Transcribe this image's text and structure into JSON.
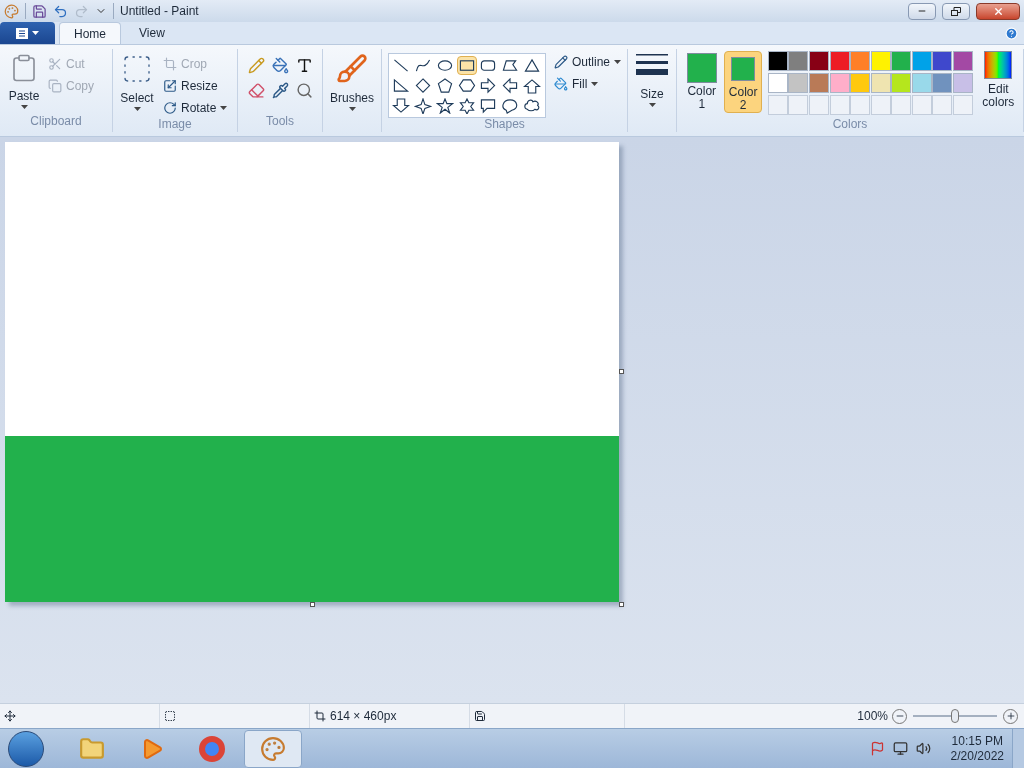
{
  "window": {
    "title": "Untitled - Paint"
  },
  "tabs": [
    {
      "label": "Home",
      "selected": true
    },
    {
      "label": "View",
      "selected": false
    }
  ],
  "clipboard": {
    "label": "Clipboard",
    "paste": "Paste",
    "cut": {
      "label": "Cut",
      "disabled": true
    },
    "copy": {
      "label": "Copy",
      "disabled": true
    }
  },
  "image": {
    "label": "Image",
    "select": "Select",
    "crop": {
      "label": "Crop",
      "disabled": true
    },
    "resize": {
      "label": "Resize",
      "disabled": false
    },
    "rotate": {
      "label": "Rotate",
      "disabled": false
    }
  },
  "tools": {
    "label": "Tools"
  },
  "brushes": {
    "button": "Brushes"
  },
  "shapes": {
    "label": "Shapes",
    "outline": "Outline",
    "fill": "Fill",
    "items": [
      {
        "kind": "line",
        "selected": false
      },
      {
        "kind": "curve",
        "selected": false
      },
      {
        "kind": "oval",
        "selected": false
      },
      {
        "kind": "rectangle",
        "selected": true
      },
      {
        "kind": "rounded",
        "selected": false
      },
      {
        "kind": "polygon",
        "selected": false
      },
      {
        "kind": "triangle",
        "selected": false
      },
      {
        "kind": "right-triangle",
        "selected": false
      },
      {
        "kind": "diamond",
        "selected": false
      },
      {
        "kind": "pentagon",
        "selected": false
      },
      {
        "kind": "hexagon",
        "selected": false
      },
      {
        "kind": "right-arrow",
        "selected": false
      },
      {
        "kind": "left-arrow",
        "selected": false
      },
      {
        "kind": "up-arrow",
        "selected": false
      },
      {
        "kind": "down-arrow",
        "selected": false
      },
      {
        "kind": "star4",
        "selected": false
      },
      {
        "kind": "star5",
        "selected": false
      },
      {
        "kind": "star6",
        "selected": false
      },
      {
        "kind": "callout-rect",
        "selected": false
      },
      {
        "kind": "callout-oval",
        "selected": false
      },
      {
        "kind": "callout-cloud",
        "selected": false
      }
    ]
  },
  "size": {
    "button": "Size"
  },
  "colors": {
    "label": "Colors",
    "color1": {
      "label": "Color 1",
      "color": "#22b14c",
      "selected": false
    },
    "color2": {
      "label": "Color 2",
      "color": "#22b14c",
      "selected": true
    },
    "palette": [
      {
        "color": "#000000"
      },
      {
        "color": "#7f7f7f"
      },
      {
        "color": "#880015"
      },
      {
        "color": "#ed1c24"
      },
      {
        "color": "#ff7f27"
      },
      {
        "color": "#fff200"
      },
      {
        "color": "#22b14c"
      },
      {
        "color": "#00a2e8"
      },
      {
        "color": "#3f48cc"
      },
      {
        "color": "#a349a4"
      },
      {
        "color": "#ffffff"
      },
      {
        "color": "#c3c3c3"
      },
      {
        "color": "#b97a57"
      },
      {
        "color": "#ffaec9"
      },
      {
        "color": "#ffc90e"
      },
      {
        "color": "#efe4b0"
      },
      {
        "color": "#b5e61d"
      },
      {
        "color": "#99d9ea"
      },
      {
        "color": "#7092be"
      },
      {
        "color": "#c8bfe7"
      }
    ],
    "edit": "Edit colors"
  },
  "status_bar": {
    "dimensions": "614 × 460px",
    "zoom": "100%",
    "zoom_level": {
      "level": 0.5
    }
  },
  "taskbar": {
    "time": "10:15 PM",
    "date": "2/20/2022"
  }
}
